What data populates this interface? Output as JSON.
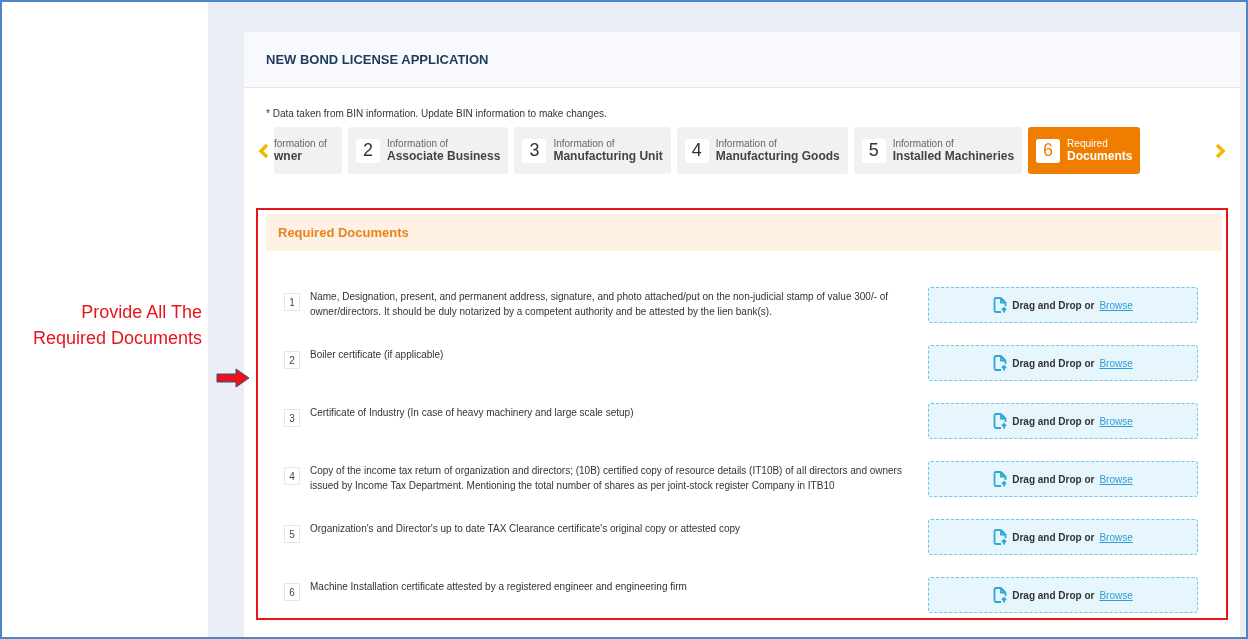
{
  "annotation": {
    "text_lines": [
      "Provide All The",
      "Required Documents"
    ]
  },
  "card": {
    "title": "NEW BOND LICENSE APPLICATION",
    "note": "* Data taken from BIN information. Update BIN information to make changes.",
    "steps": [
      {
        "caption": "formation of",
        "label": "wner",
        "selected": false
      },
      {
        "number": "2",
        "caption": "Information of",
        "label": "Associate Business",
        "selected": false
      },
      {
        "number": "3",
        "caption": "Information of",
        "label": "Manufacturing Unit",
        "selected": false
      },
      {
        "number": "4",
        "caption": "Information of",
        "label": "Manufacturing Goods",
        "selected": false
      },
      {
        "number": "5",
        "caption": "Information of",
        "label": "Installed Machineries",
        "selected": false
      },
      {
        "number": "6",
        "caption": "Required",
        "label": "Documents",
        "selected": true
      }
    ],
    "section": {
      "title": "Required Documents",
      "documents": [
        {
          "number": "1",
          "text": "Name, Designation, present, and permanent address, signature, and photo attached/put on the non-judicial stamp of value 300/- of owner/directors. It should be duly notarized by a competent authority and be attested by the lien bank(s).",
          "upload": "Drag and Drop or",
          "link": "Browse"
        },
        {
          "number": "2",
          "text": "Boiler certificate (if applicable)",
          "upload": "Drag and Drop or",
          "link": "Browse"
        },
        {
          "number": "3",
          "text": "Certificate of Industry (In case of heavy machinery and large scale setup)",
          "upload": "Drag and Drop or",
          "link": "Browse"
        },
        {
          "number": "4",
          "text": "Copy of the income tax return of organization and directors; (10B) certified copy of resource details (IT10B) of all directors and owners issued by Income Tax Department. Mentioning the total number of shares as per joint-stock register Company in ITB10",
          "upload": "Drag and Drop or",
          "link": "Browse"
        },
        {
          "number": "5",
          "text": "Organization's and Director's up to date TAX Clearance certificate's original copy or attested copy",
          "upload": "Drag and Drop or",
          "link": "Browse"
        },
        {
          "number": "6",
          "text": "Machine Installation certificate attested by a registered engineer and engineering firm",
          "upload": "Drag and Drop or",
          "link": "Browse"
        }
      ]
    }
  }
}
